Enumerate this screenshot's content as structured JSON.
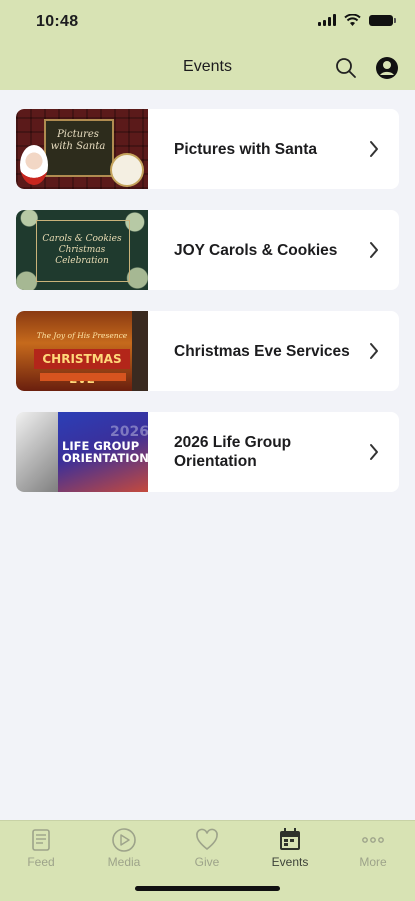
{
  "status_bar": {
    "time": "10:48"
  },
  "nav": {
    "title": "Events"
  },
  "events": [
    {
      "title": "Pictures with Santa",
      "thumb_text": "Pictures with Santa"
    },
    {
      "title": "JOY Carols & Cookies",
      "thumb_text": "Carols & Cookies Christmas Celebration"
    },
    {
      "title": "Christmas Eve Services",
      "thumb_text": "CHRISTMAS EVE",
      "thumb_script": "The Joy of His Presence"
    },
    {
      "title": "2026 Life Group Orientation",
      "thumb_text": "LIFE GROUP ORIENTATION",
      "thumb_num": "2026"
    }
  ],
  "tabbar": {
    "items": [
      {
        "label": "Feed",
        "icon": "feed-icon",
        "active": false
      },
      {
        "label": "Media",
        "icon": "play-icon",
        "active": false
      },
      {
        "label": "Give",
        "icon": "heart-icon",
        "active": false
      },
      {
        "label": "Events",
        "icon": "calendar-icon",
        "active": true
      },
      {
        "label": "More",
        "icon": "more-icon",
        "active": false
      }
    ]
  },
  "colors": {
    "header_bg": "#d8e3b4",
    "page_bg": "#f2f3f8",
    "tab_inactive": "#9da38a",
    "tab_active": "#3d4239"
  }
}
